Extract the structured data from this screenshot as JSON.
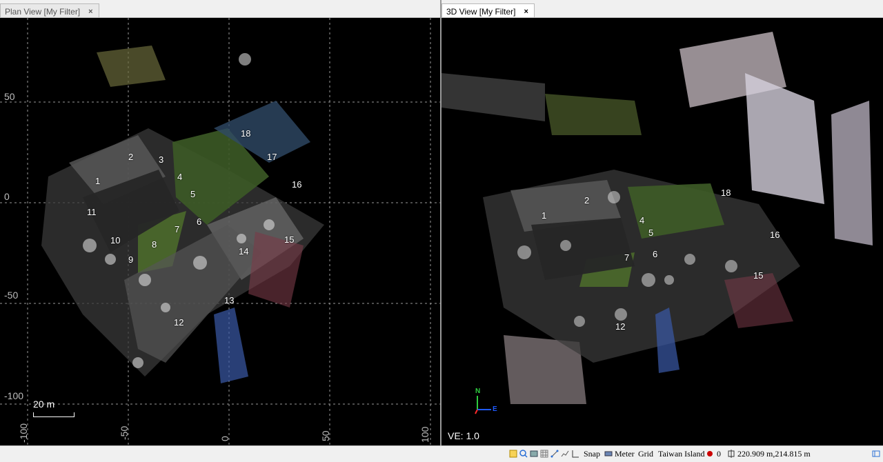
{
  "tabs": {
    "plan": {
      "label": "Plan View [My Filter]",
      "close": "×"
    },
    "view3d": {
      "label": "3D View [My Filter]",
      "close": "×"
    }
  },
  "plan_view": {
    "axis_left": [
      "50",
      "0",
      "-50",
      "-100"
    ],
    "axis_bottom": [
      "-100",
      "-50",
      "0",
      "50",
      "100"
    ],
    "scale_label": "20 m",
    "markers": [
      "1",
      "2",
      "3",
      "4",
      "5",
      "6",
      "7",
      "8",
      "9",
      "10",
      "11",
      "12",
      "13",
      "14",
      "15",
      "16",
      "17",
      "18"
    ]
  },
  "view3d": {
    "markers": [
      "1",
      "2",
      "4",
      "5",
      "6",
      "7",
      "12",
      "15",
      "16",
      "18"
    ],
    "ve_label": "VE: 1.0",
    "gizmo": {
      "n": "N",
      "e": "E"
    }
  },
  "status": {
    "snap": "Snap",
    "unit": "Meter",
    "grid": "Grid",
    "projection": "Taiwan Island",
    "count": "0",
    "coords": "220.909 m,214.815 m"
  }
}
